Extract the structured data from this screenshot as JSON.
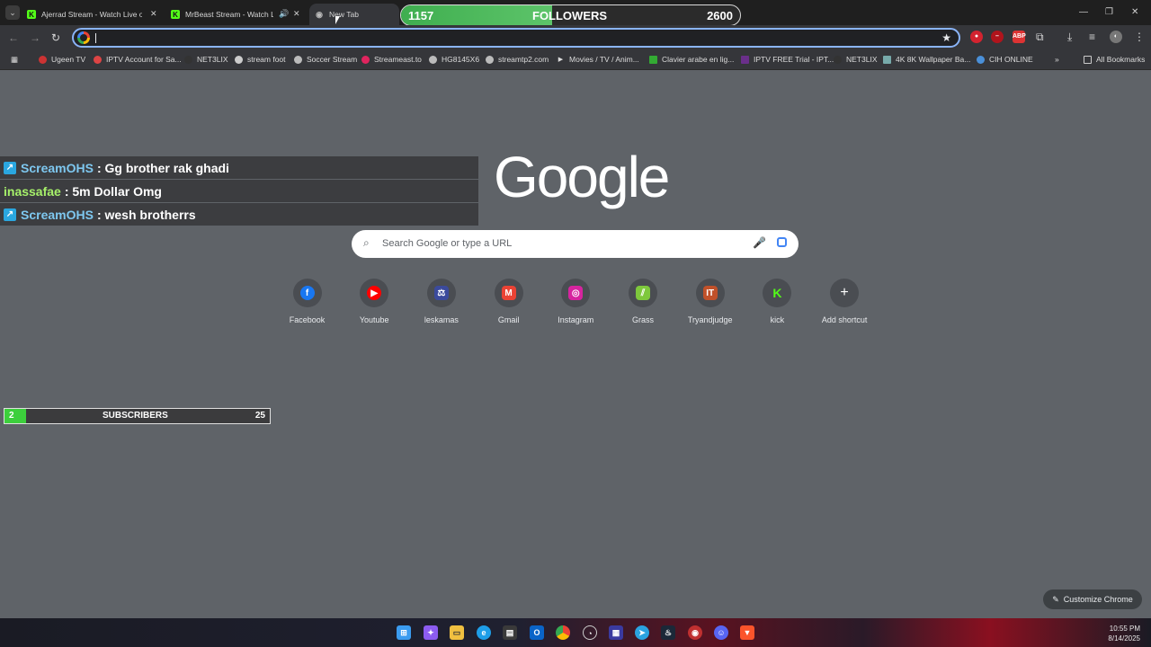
{
  "tabs": [
    {
      "title": "Ajerrad Stream - Watch Live on",
      "icon": "kick-icon"
    },
    {
      "title": "MrBeast Stream - Watch Li",
      "icon": "kick-icon"
    },
    {
      "title": "New Tab",
      "icon": "chrome-icon"
    }
  ],
  "followers": {
    "current": "1157",
    "label": "FOLLOWERS",
    "goal": "2600",
    "progress": 0.445
  },
  "omnibox": {
    "value": ""
  },
  "bookmarks": [
    "Ugeen TV",
    "IPTV Account for Sa...",
    "NET3LIX",
    "stream foot",
    "Soccer Stream",
    "Streameast.to",
    "HG8145X6",
    "streamtp2.com",
    "Movies / TV / Anim...",
    "Clavier arabe en lig...",
    "IPTV FREE Trial - IPT...",
    "NET3LIX",
    "4K 8K Wallpaper Ba...",
    "CIH ONLINE"
  ],
  "all_bookmarks": "All Bookmarks",
  "chat": [
    {
      "user": "ScreamOHS",
      "message": ": Gg brother rak ghadi",
      "user_color": "#7ec8f0",
      "badge": true
    },
    {
      "user": "inassafae",
      "message": ": 5m Dollar Omg",
      "user_color": "#a6f06a",
      "badge": false
    },
    {
      "user": "ScreamOHS",
      "message": ": wesh brotherrs",
      "user_color": "#7ec8f0",
      "badge": true
    }
  ],
  "google": {
    "logo": "Google",
    "placeholder": "Search Google or type a URL"
  },
  "shortcuts": [
    {
      "label": "Facebook",
      "icon": "facebook-icon",
      "glyph": "f",
      "color": "#1877f2"
    },
    {
      "label": "Youtube",
      "icon": "youtube-icon",
      "glyph": "▶",
      "color": "#ff0000"
    },
    {
      "label": "leskamas",
      "icon": "scales-icon",
      "glyph": "⚖",
      "color": "#3b4a9c"
    },
    {
      "label": "Gmail",
      "icon": "gmail-icon",
      "glyph": "M",
      "color": "#ea4335"
    },
    {
      "label": "Instagram",
      "icon": "instagram-icon",
      "glyph": "◎",
      "color": "#d6249f"
    },
    {
      "label": "Grass",
      "icon": "grass-icon",
      "glyph": "⫽",
      "color": "#7ec83c"
    },
    {
      "label": "Tryandjudge",
      "icon": "tryandjudge-icon",
      "glyph": "IT",
      "color": "#c0512a"
    },
    {
      "label": "kick",
      "icon": "kick-icon",
      "glyph": "K",
      "color": "#53fc18"
    },
    {
      "label": "Add shortcut",
      "icon": "plus-icon",
      "glyph": "+",
      "color": "transparent"
    }
  ],
  "subscribers": {
    "current": "2",
    "label": "SUBSCRIBERS",
    "goal": "25",
    "progress": 0.08
  },
  "customize_label": "Customize Chrome",
  "clock": {
    "time": "10:55 PM",
    "date": "8/14/2025"
  }
}
